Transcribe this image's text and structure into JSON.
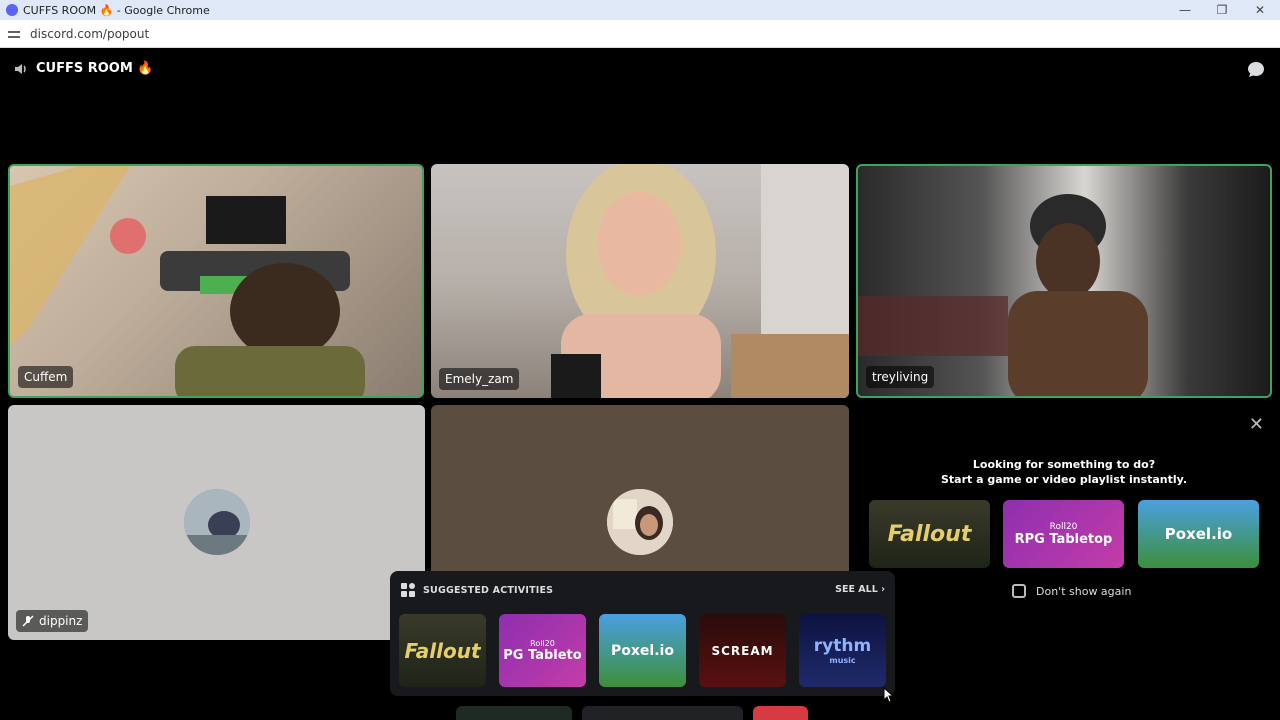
{
  "browser": {
    "window_title": "CUFFS ROOM 🔥 - Google Chrome",
    "url": "discord.com/popout"
  },
  "header": {
    "room_name": "CUFFS ROOM 🔥"
  },
  "participants": [
    {
      "name": "Cuffem",
      "has_video": true,
      "speaking": true
    },
    {
      "name": "Emely_zam",
      "has_video": true,
      "speaking": false
    },
    {
      "name": "treyliving",
      "has_video": true,
      "speaking": true
    },
    {
      "name": "dippinz",
      "has_video": false,
      "muted": true
    },
    {
      "name": "",
      "has_video": false
    }
  ],
  "suggestions_panel": {
    "line1": "Looking for something to do?",
    "line2": "Start a game or video playlist instantly.",
    "games": [
      {
        "label": "Fallout"
      },
      {
        "label": "RPG Tabletop",
        "brand": "Roll20"
      },
      {
        "label": "Poxel.io"
      }
    ],
    "dont_show_label": "Don't show again"
  },
  "activities_popover": {
    "title": "SUGGESTED ACTIVITIES",
    "see_all": "SEE ALL",
    "items": [
      {
        "label": "Fallout"
      },
      {
        "label": "PG Tableto",
        "brand": "Roll20"
      },
      {
        "label": "Poxel.io"
      },
      {
        "label": "SCREAM"
      },
      {
        "label": "rythm",
        "sub": "music"
      }
    ]
  },
  "colors": {
    "speaking_border": "#3ba55d",
    "blurple": "#5865f2",
    "danger": "#d83a42"
  }
}
